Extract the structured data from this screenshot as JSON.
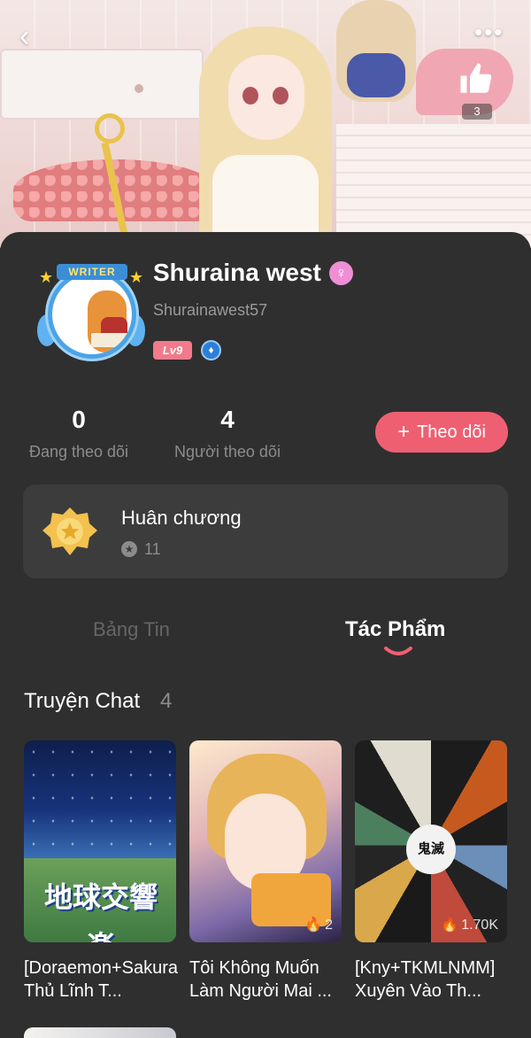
{
  "header": {
    "back_icon": "chevron-left-icon",
    "more_icon": "more-horizontal-icon",
    "like_icon": "thumbs-up-icon",
    "like_count": "3"
  },
  "profile": {
    "name": "Shuraina west",
    "gender_icon": "female-icon",
    "handle": "Shurainawest57",
    "level": "Lv9",
    "avatar_frame_label": "WRITER",
    "rank_icon": "rank-drop-icon"
  },
  "stats": {
    "following": {
      "value": "0",
      "label": "Đang theo dõi"
    },
    "followers": {
      "value": "4",
      "label": "Người theo dõi"
    }
  },
  "follow_button": {
    "label": "Theo dõi"
  },
  "medals": {
    "title": "Huân chương",
    "count": "11"
  },
  "tabs": [
    {
      "label": "Bảng Tin",
      "active": false
    },
    {
      "label": "Tác Phẩm",
      "active": true
    }
  ],
  "section": {
    "title": "Truyện Chat",
    "count": "4"
  },
  "stories": [
    {
      "title": "[Doraemon+Sakura Thủ Lĩnh T...",
      "cover_text": "地球交響楽",
      "views": ""
    },
    {
      "title": "Tôi Không Muốn Làm Người Mai ...",
      "views": "2"
    },
    {
      "title": "[Kny+TKMLNMM] Xuyên Vào Th...",
      "cover_text": "鬼滅",
      "views": "1.70K"
    }
  ],
  "colors": {
    "accent": "#ef5f72",
    "background": "#2f2f2f",
    "card": "#3c3c3c",
    "muted_text": "#8c8c8c"
  }
}
